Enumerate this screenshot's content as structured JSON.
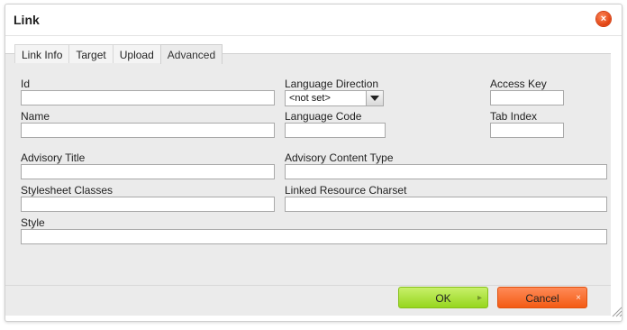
{
  "dialog": {
    "title": "Link",
    "close_glyph": "×",
    "close_icon": "close-icon"
  },
  "tabs": [
    {
      "label": "Link Info",
      "active": false
    },
    {
      "label": "Target",
      "active": false
    },
    {
      "label": "Upload",
      "active": false
    },
    {
      "label": "Advanced",
      "active": true
    }
  ],
  "form": {
    "id_label": "Id",
    "id_value": "",
    "language_direction_label": "Language Direction",
    "language_direction_value": "<not set>",
    "access_key_label": "Access Key",
    "access_key_value": "",
    "name_label": "Name",
    "name_value": "",
    "language_code_label": "Language Code",
    "language_code_value": "",
    "tab_index_label": "Tab Index",
    "tab_index_value": "",
    "advisory_title_label": "Advisory Title",
    "advisory_title_value": "",
    "advisory_content_type_label": "Advisory Content Type",
    "advisory_content_type_value": "",
    "stylesheet_classes_label": "Stylesheet Classes",
    "stylesheet_classes_value": "",
    "linked_resource_charset_label": "Linked Resource Charset",
    "linked_resource_charset_value": "",
    "style_label": "Style",
    "style_value": ""
  },
  "footer": {
    "ok_label": "OK",
    "ok_glyph": "▸",
    "cancel_label": "Cancel",
    "cancel_glyph": "×"
  },
  "colors": {
    "ok_button": "#96d61e",
    "cancel_button": "#f35b14",
    "close_button": "#e0400f",
    "panel_background": "#ebebeb"
  }
}
